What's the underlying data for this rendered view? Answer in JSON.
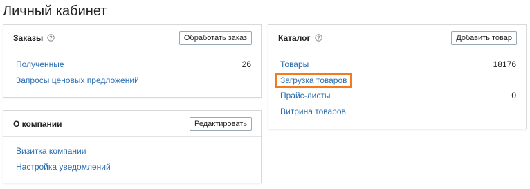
{
  "page": {
    "title": "Личный кабинет"
  },
  "orders": {
    "title": "Заказы",
    "button": "Обработать заказ",
    "items": [
      {
        "label": "Полученные",
        "count": "26"
      },
      {
        "label": "Запросы ценовых предложений",
        "count": ""
      }
    ]
  },
  "company": {
    "title": "О компании",
    "button": "Редактировать",
    "items": [
      {
        "label": "Визитка компании"
      },
      {
        "label": "Настройка уведомлений"
      }
    ]
  },
  "catalog": {
    "title": "Каталог",
    "button": "Добавить товар",
    "items": [
      {
        "label": "Товары",
        "count": "18176"
      },
      {
        "label": "Загрузка товаров",
        "count": "",
        "highlighted": true
      },
      {
        "label": "Прайс-листы",
        "count": "0"
      },
      {
        "label": "Витрина товаров",
        "count": ""
      }
    ]
  },
  "colors": {
    "link": "#2a6db0",
    "highlight": "#f47a20",
    "border": "#d9d9d9"
  },
  "icons": {
    "help": "question-circle-icon"
  }
}
